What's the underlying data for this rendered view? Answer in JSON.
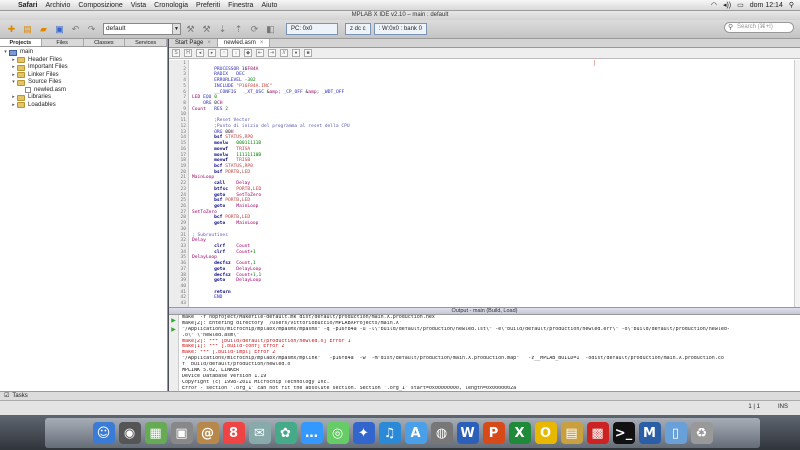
{
  "menubar": {
    "apple": "",
    "items": [
      "Safari",
      "Archivio",
      "Composizione",
      "Vista",
      "Cronologia",
      "Preferiti",
      "Finestra",
      "Aiuto"
    ],
    "clock": "dom 12:14"
  },
  "window": {
    "title": "MPLAB X IDE v2.10 – main : default"
  },
  "toolbar": {
    "config": "default",
    "pc": "PC: 0x0",
    "flags": "z dc c",
    "wreg": ": W:0x0 : bank 0",
    "search_placeholder": "Search (⌘+I)"
  },
  "leftpanel": {
    "tabs": [
      "Projects",
      "Files",
      "Classes",
      "Services"
    ],
    "tree": [
      {
        "label": "main",
        "indent": 0,
        "twisty": "▾",
        "icon": "proj"
      },
      {
        "label": "Header Files",
        "indent": 1,
        "twisty": "▸",
        "icon": "folder"
      },
      {
        "label": "Important Files",
        "indent": 1,
        "twisty": "▸",
        "icon": "folder"
      },
      {
        "label": "Linker Files",
        "indent": 1,
        "twisty": "▸",
        "icon": "folder"
      },
      {
        "label": "Source Files",
        "indent": 1,
        "twisty": "▾",
        "icon": "folder"
      },
      {
        "label": "newled.asm",
        "indent": 2,
        "twisty": "",
        "icon": "file"
      },
      {
        "label": "Libraries",
        "indent": 1,
        "twisty": "▸",
        "icon": "folder"
      },
      {
        "label": "Loadables",
        "indent": 1,
        "twisty": "▸",
        "icon": "folder"
      }
    ]
  },
  "editor": {
    "tabs": [
      "Start Page",
      "newled.asm"
    ],
    "lines": [
      "",
      "        PROCESSOR 16F84A",
      "        RADIX   DEC",
      "        ERRORLEVEL -302",
      "        INCLUDE \"P16F84A.INC\"",
      "        __CONFIG   _XT_OSC & _CP_OFF & _WDT_OFF",
      "LED EQU 0",
      "    ORG 0CH",
      "Count   RES 2",
      "",
      "        ;Reset Vector",
      "        ;Punto di inizio del programma al reset della CPU",
      "        ORG 00H",
      "        bsf STATUS,RP0",
      "        movlw   00011111B",
      "        movwf   TRISA",
      "        movlw   11111110B",
      "        movwf   TRISB",
      "        bcf STATUS,RP0",
      "        bsf PORTB,LED",
      "MainLoop",
      "        call    Delay",
      "        btfsc   PORTB,LED",
      "        goto    SetToZero",
      "        bsf PORTB,LED",
      "        goto    MainLoop",
      "SetToZero",
      "        bcf PORTB,LED",
      "        goto    MainLoop",
      "",
      "; Subroutines",
      "Delay",
      "        clrf    Count",
      "        clrf    Count+1",
      "DelayLoop",
      "        decfsz  Count,1",
      "        goto    DelayLoop",
      "        decfsz  Count+1,1",
      "        goto    DelayLoop",
      "",
      "        return",
      "        END",
      ""
    ]
  },
  "output": {
    "title": "Output - main (Build, Load)",
    "lines": [
      {
        "t": "make  -f nbproject/Makefile-default.mk dist/default/production/main.X.production.hex",
        "c": ""
      },
      {
        "t": "make[2]: Entering directory `/Users/vittoriobuccio/MPLABXProjects/main.X'",
        "c": ""
      },
      {
        "t": "\"/Applications/microchip/mplabx/mpasmx/mpasmx\" -q -p16f84a -u -l\\\"build/default/production/newled.lst\\\" -e\\\"build/default/production/newled.err\\\" -o\\\"build/default/production/newled-",
        "c": ""
      },
      {
        "t": ".o\\\" \\\"newled.asm\\\"",
        "c": ""
      },
      {
        "t": "make[2]: *** [build/default/production/newled.o] Error 1",
        "c": "err"
      },
      {
        "t": "make[1]: *** [.build-conf] Error 2",
        "c": "err"
      },
      {
        "t": "make: *** [.build-impl] Error 2",
        "c": "err"
      },
      {
        "t": "\"/Applications/microchip/mplabx/mpasmx/mplink\"   -p16f84a  -w  -m\"dist/default/production/main.X.production.map\"   -z__MPLAB_BUILD=1  -odist/default/production/main.X.production.co",
        "c": ""
      },
      {
        "t": "f  build/default/production/newled.o",
        "c": ""
      },
      {
        "t": "MPLINK 5.02, LINKER",
        "c": ""
      },
      {
        "t": "Device Database Version 1.19",
        "c": ""
      },
      {
        "t": "Copyright (c) 1998-2011 Microchip Technology Inc.",
        "c": ""
      },
      {
        "t": "Error - section '.org_1' can not fit the absolute section. Section '.org_1' start=0x00000000, length=0x0000002a",
        "c": ""
      }
    ]
  },
  "tasks": {
    "label": "Tasks"
  },
  "status": {
    "position": "1 | 1",
    "mode": "INS"
  },
  "dock": [
    {
      "name": "finder-icon",
      "glyph": "☺",
      "color": "#3a7bd5"
    },
    {
      "name": "dashboard-icon",
      "glyph": "◉",
      "color": "#555"
    },
    {
      "name": "photo-icon",
      "glyph": "▦",
      "color": "#6a5"
    },
    {
      "name": "preview-icon",
      "glyph": "▣",
      "color": "#888"
    },
    {
      "name": "contacts-icon",
      "glyph": "@",
      "color": "#b8874a"
    },
    {
      "name": "calendar-icon",
      "glyph": "8",
      "color": "#e44"
    },
    {
      "name": "mail-icon",
      "glyph": "✉",
      "color": "#8aa"
    },
    {
      "name": "iphoto-icon",
      "glyph": "✿",
      "color": "#4a8"
    },
    {
      "name": "chat-icon",
      "glyph": "…",
      "color": "#39f"
    },
    {
      "name": "facetime-icon",
      "glyph": "◎",
      "color": "#6c6"
    },
    {
      "name": "safari-icon",
      "glyph": "✦",
      "color": "#36c"
    },
    {
      "name": "itunes-icon",
      "glyph": "♫",
      "color": "#2a8ad8"
    },
    {
      "name": "appstore-icon",
      "glyph": "A",
      "color": "#4aa0e8"
    },
    {
      "name": "network-icon",
      "glyph": "◍",
      "color": "#777"
    },
    {
      "name": "word-icon",
      "glyph": "W",
      "color": "#2b5fb8"
    },
    {
      "name": "powerpoint-icon",
      "glyph": "P",
      "color": "#d64a1a"
    },
    {
      "name": "excel-icon",
      "glyph": "X",
      "color": "#1e8a3a"
    },
    {
      "name": "outlook-icon",
      "glyph": "O",
      "color": "#e8b800"
    },
    {
      "name": "ruler-icon",
      "glyph": "▤",
      "color": "#c8a040"
    },
    {
      "name": "chess-icon",
      "glyph": "▩",
      "color": "#c22"
    },
    {
      "name": "terminal-icon",
      "glyph": ">_",
      "color": "#111"
    },
    {
      "name": "mplab-icon",
      "glyph": "M",
      "color": "#2a5fa8"
    },
    {
      "name": "folder-icon",
      "glyph": "▯",
      "color": "#6aa0d8"
    },
    {
      "name": "trash-icon",
      "glyph": "♻",
      "color": "#999"
    }
  ]
}
